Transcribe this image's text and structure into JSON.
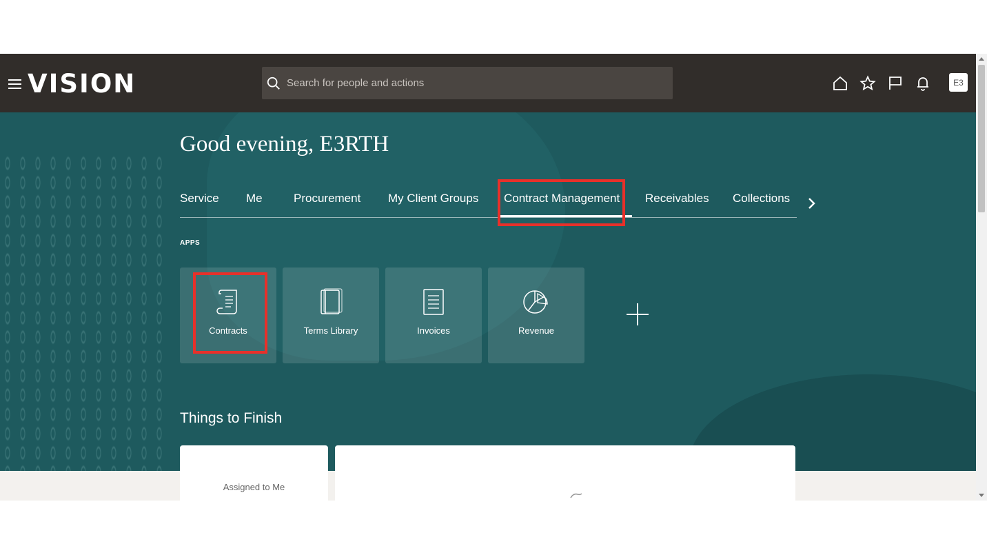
{
  "header": {
    "logo": "VISION",
    "search_placeholder": "Search for people and actions",
    "icons": [
      "home-icon",
      "star-icon",
      "flag-icon",
      "bell-icon"
    ],
    "avatar_initials": "E3"
  },
  "hero": {
    "greeting": "Good evening, E3RTH",
    "tabs": [
      {
        "label": "Service"
      },
      {
        "label": "Me"
      },
      {
        "label": "Procurement"
      },
      {
        "label": "My Client Groups"
      },
      {
        "label": "Contract Management",
        "active": true
      },
      {
        "label": "Receivables"
      },
      {
        "label": "Collections"
      }
    ],
    "apps_label": "APPS",
    "apps": [
      {
        "label": "Contracts",
        "icon": "scroll-icon"
      },
      {
        "label": "Terms Library",
        "icon": "book-icon"
      },
      {
        "label": "Invoices",
        "icon": "document-icon"
      },
      {
        "label": "Revenue",
        "icon": "pie-chart-icon"
      }
    ],
    "section_title": "Things to Finish"
  },
  "cards": {
    "assigned_label": "Assigned to Me"
  },
  "colors": {
    "header_bg": "#312d2a",
    "hero_bg": "#1e5a5e",
    "highlight": "#e8302a"
  }
}
